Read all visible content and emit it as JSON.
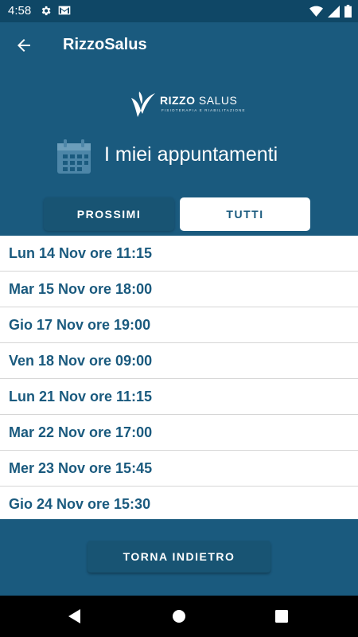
{
  "status_bar": {
    "time": "4:58",
    "left_icons": [
      "gear-icon",
      "gmail-icon"
    ],
    "right_icons": [
      "wifi-icon",
      "signal-icon",
      "battery-icon"
    ]
  },
  "app_bar": {
    "title": "RizzoSalus",
    "back_icon": "arrow-back-icon"
  },
  "logo": {
    "brand_bold": "RIZZO",
    "brand_light": " SALUS",
    "tagline": "FISIOTERAPIA E RIABILITAZIONE"
  },
  "header": {
    "icon": "calendar-icon",
    "title": "I miei appuntamenti"
  },
  "tabs": [
    {
      "label": "PROSSIMI",
      "selected": false
    },
    {
      "label": "TUTTI",
      "selected": true
    }
  ],
  "appointments": [
    "Lun 14 Nov ore 11:15",
    "Mar 15 Nov ore 18:00",
    "Gio 17 Nov ore 19:00",
    "Ven 18 Nov ore 09:00",
    "Lun 21 Nov ore 11:15",
    "Mar 22 Nov ore 17:00",
    "Mer 23 Nov ore 15:45",
    "Gio 24 Nov ore 15:30"
  ],
  "back_button": {
    "label": "TORNA INDIETRO"
  },
  "nav_bar": {
    "buttons": [
      "back-triangle-icon",
      "home-circle-icon",
      "recents-square-icon"
    ]
  },
  "colors": {
    "primary": "#1a5a7e",
    "status_bar": "#0f4766",
    "list_background": "#ffffff",
    "accent_text": "#1a5a7e"
  }
}
